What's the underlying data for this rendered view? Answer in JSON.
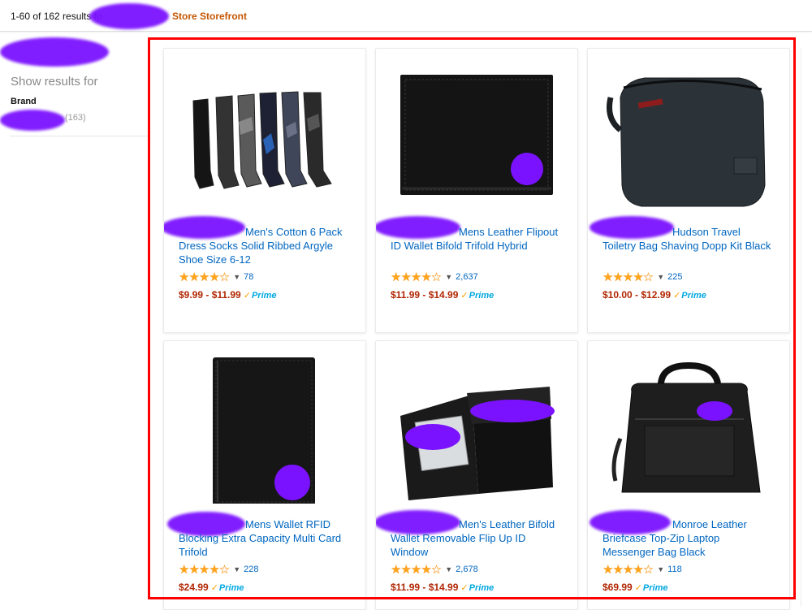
{
  "header": {
    "results_text": "1-60 of 162 results fo",
    "store_label": "Store Storefront"
  },
  "sidebar": {
    "show_results_label": "Show results for",
    "brand_heading": "Brand",
    "brand_count": "(163)"
  },
  "products": [
    {
      "title": "Men's Cotton 6 Pack Dress Socks Solid Ribbed Argyle Shoe Size 6-12",
      "rating": 4.5,
      "reviews": "78",
      "price": "$9.99 - $11.99",
      "prime": "Prime"
    },
    {
      "title": "Mens Leather Flipout ID Wallet Bifold Trifold Hybrid",
      "rating": 4.5,
      "reviews": "2,637",
      "price": "$11.99 - $14.99",
      "prime": "Prime"
    },
    {
      "title": "Hudson Travel Toiletry Bag Shaving Dopp Kit Black",
      "rating": 4.5,
      "reviews": "225",
      "price": "$10.00 - $12.99",
      "prime": "Prime"
    },
    {
      "title": "Mens Wallet RFID Blocking Extra Capacity Multi Card Trifold",
      "rating": 4.5,
      "reviews": "228",
      "price": "$24.99",
      "prime": "Prime"
    },
    {
      "title": "Men's Leather Bifold Wallet Removable Flip Up ID Window",
      "rating": 4.5,
      "reviews": "2,678",
      "price": "$11.99 - $14.99",
      "prime": "Prime"
    },
    {
      "title": "Monroe Leather Briefcase Top-Zip Laptop Messenger Bag Black",
      "rating": 4.5,
      "reviews": "118",
      "price": "$69.99",
      "prime": "Prime"
    }
  ],
  "icons": {
    "stars": "star-rating-icon",
    "dropdown": "chevron-down-icon",
    "prime_check": "prime-check-icon"
  },
  "colors": {
    "link": "#0066c0",
    "price": "#b12704",
    "store": "#c45500",
    "highlight_frame": "#ff0000",
    "redaction": "#7b12ff"
  }
}
